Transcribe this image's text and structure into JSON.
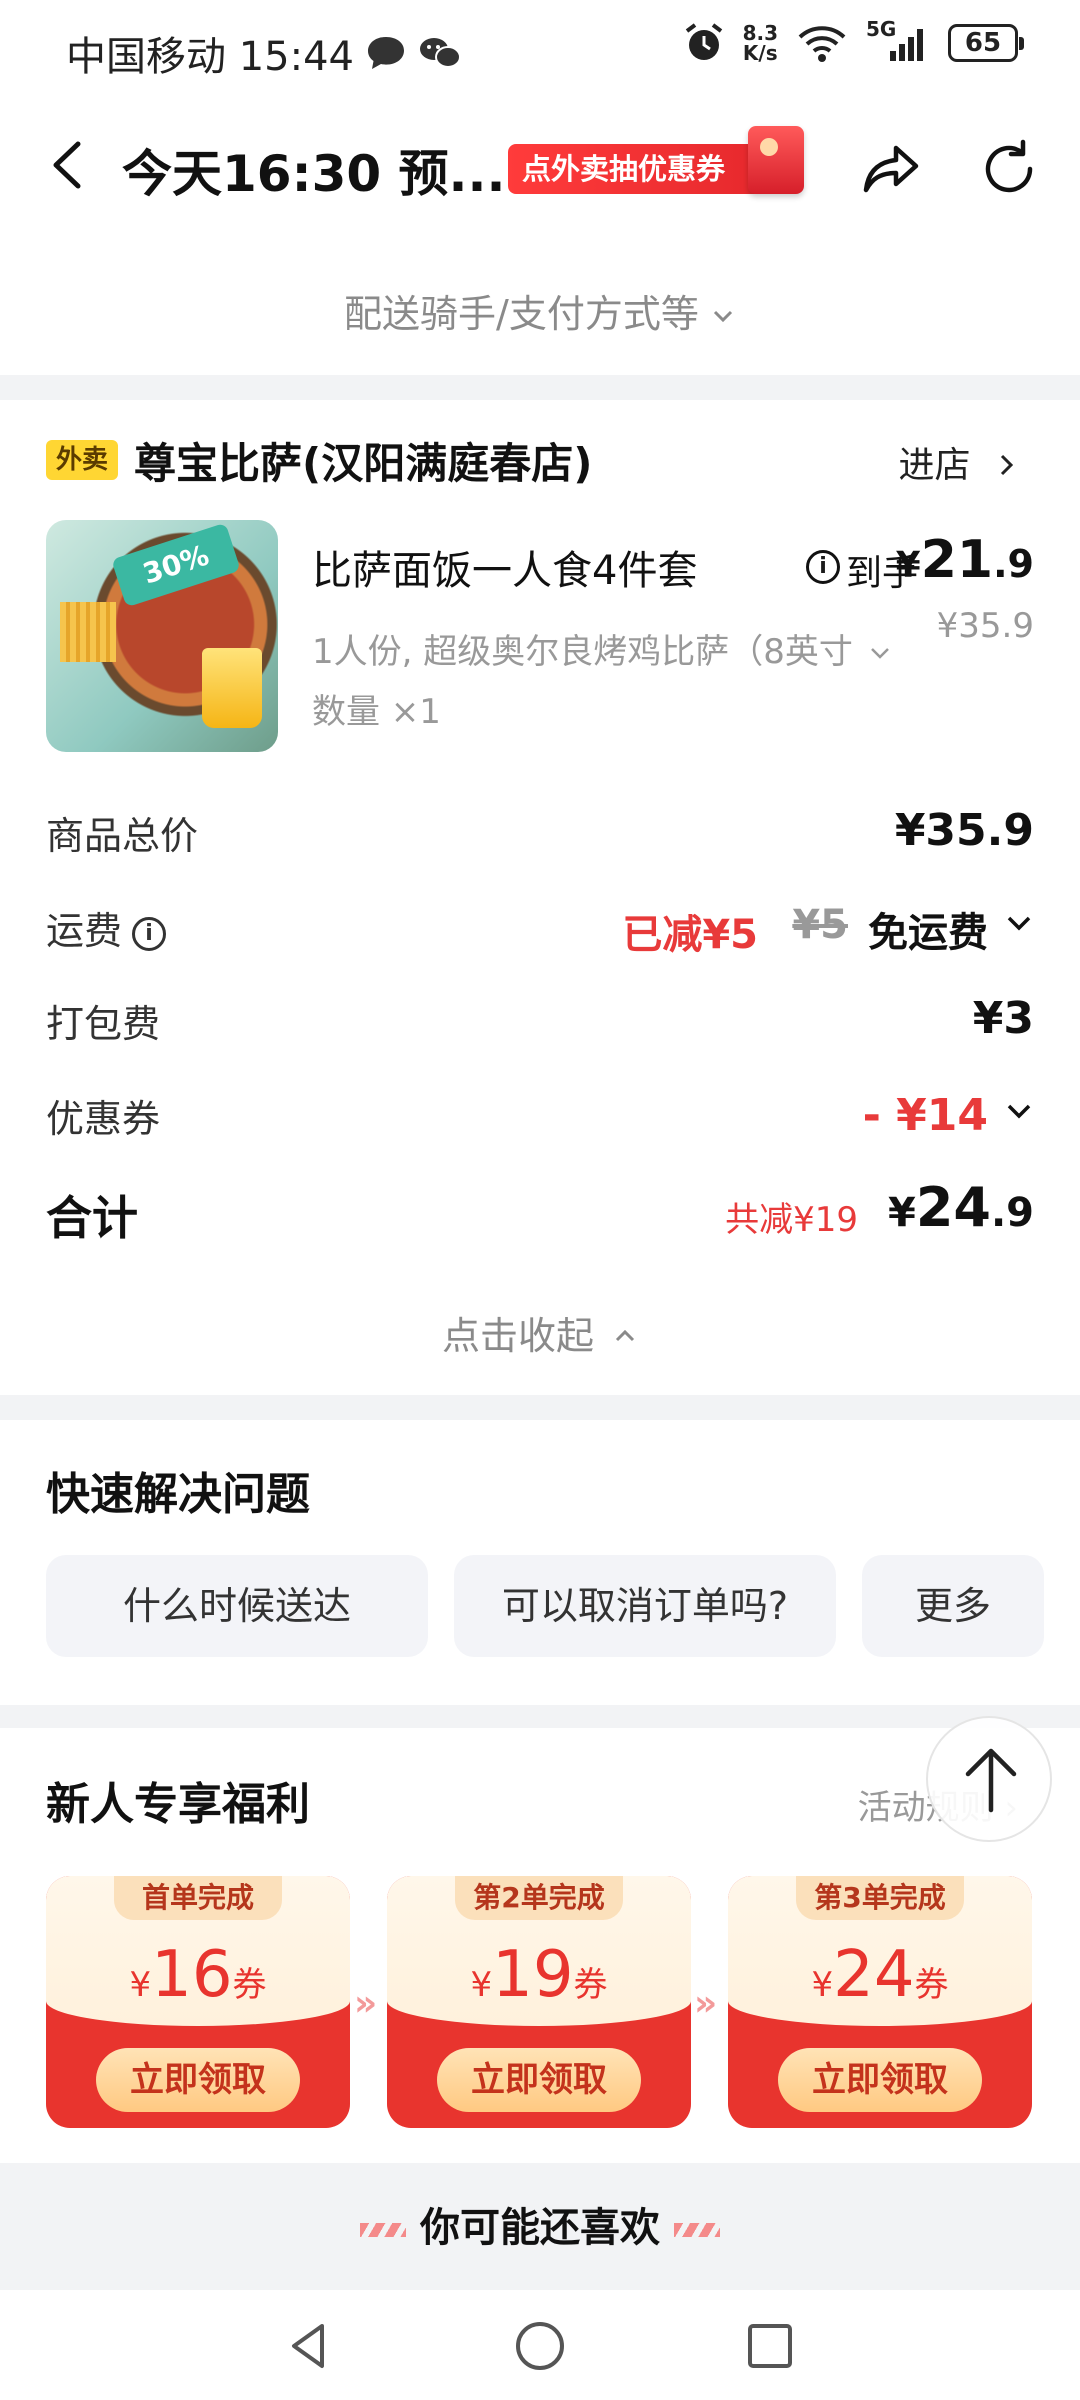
{
  "status_bar": {
    "carrier_time": "中国移动 15:44",
    "net_speed_value": "8.3",
    "net_speed_unit": "K/s",
    "signal_label": "5G",
    "battery": "65"
  },
  "header": {
    "title": "今天16:30 预...",
    "coupon_banner": "点外卖抽优惠券"
  },
  "delivery_options": "配送骑手/支付方式等",
  "store": {
    "tag": "外卖",
    "name": "尊宝比萨(汉阳满庭春店)",
    "enter_label": "进店"
  },
  "product": {
    "name": "比萨面饭一人食4件套",
    "price_label": "到手",
    "price_yen": "¥",
    "price_int": "21",
    "price_dec": ".9",
    "original_price": "¥35.9",
    "spec": "1人份, 超级奥尔良烤鸡比萨（8英寸",
    "quantity": "数量 ×1"
  },
  "fees": {
    "goods_total_label": "商品总价",
    "goods_total_value": "¥35.9",
    "shipping_label": "运费",
    "shipping_reduced": "已减¥5",
    "shipping_original": "¥5",
    "shipping_free": "免运费",
    "packing_label": "打包费",
    "packing_value": "¥3",
    "coupon_label": "优惠券",
    "coupon_value": "- ¥14",
    "total_label": "合计",
    "total_saved": "共减¥19",
    "total_yen": "¥",
    "total_int": "24",
    "total_dec": ".9",
    "collapse_label": "点击收起"
  },
  "quick_solve": {
    "title": "快速解决问题",
    "buttons": [
      "什么时候送达",
      "可以取消订单吗?",
      "更多"
    ]
  },
  "newcomer": {
    "title": "新人专享福利",
    "rules": "活动规则",
    "coupons": [
      {
        "tag": "首单完成",
        "yen": "¥",
        "amount": "16",
        "unit": "券",
        "claim": "立即领取"
      },
      {
        "tag": "第2单完成",
        "yen": "¥",
        "amount": "19",
        "unit": "券",
        "claim": "立即领取"
      },
      {
        "tag": "第3单完成",
        "yen": "¥",
        "amount": "24",
        "unit": "券",
        "claim": "立即领取"
      }
    ]
  },
  "recommend_title": "你可能还喜欢",
  "colors": {
    "accent_red": "#e83a3a",
    "tag_yellow": "#ffd633",
    "coupon_red": "#e8342e"
  },
  "icons": {
    "back": "chevron-left-icon",
    "share": "share-arrow-icon",
    "refresh": "refresh-icon",
    "info": "info-icon",
    "back_to_top": "arrow-up-icon",
    "nav": [
      "back-triangle-icon",
      "home-circle-icon",
      "recents-square-icon"
    ]
  }
}
